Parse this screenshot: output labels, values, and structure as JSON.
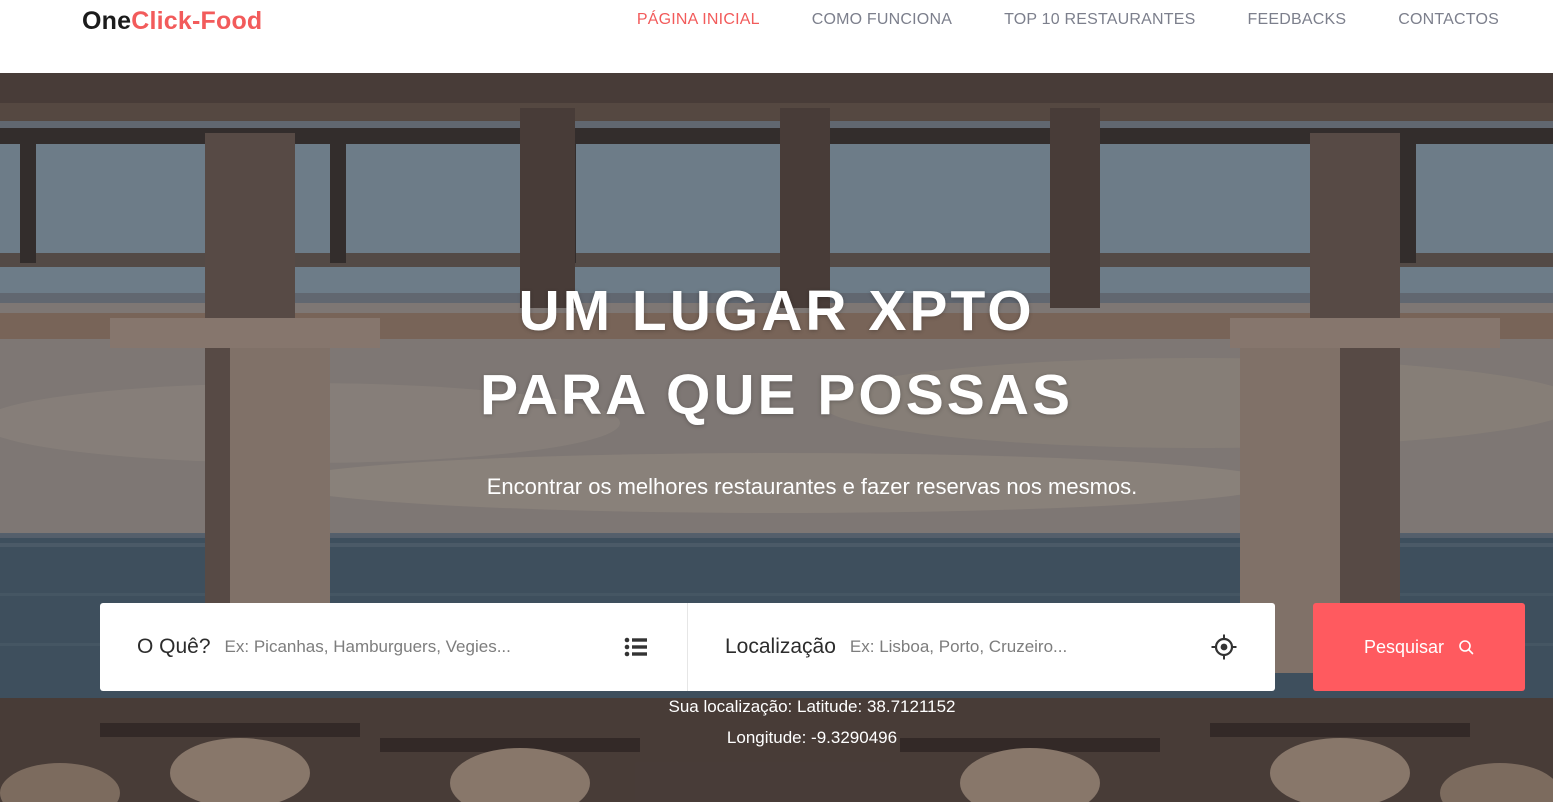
{
  "header": {
    "logo_part_a": "One",
    "logo_part_b": "Click-Food",
    "nav": [
      {
        "label": "PÁGINA INICIAL",
        "active": true
      },
      {
        "label": "COMO FUNCIONA",
        "active": false
      },
      {
        "label": "TOP 10 RESTAURANTES",
        "active": false
      },
      {
        "label": "FEEDBACKS",
        "active": false
      },
      {
        "label": "CONTACTOS",
        "active": false
      }
    ]
  },
  "hero": {
    "title_line1": "UM LUGAR XPTO",
    "title_line2": "PARA QUE POSSAS",
    "subtitle": "Encontrar os melhores restaurantes e fazer reservas nos mesmos."
  },
  "search": {
    "what_label": "O Quê?",
    "what_placeholder": "Ex: Picanhas, Hamburguers, Vegies...",
    "what_icon": "list-icon",
    "location_label": "Localização",
    "location_placeholder": "Ex: Lisboa, Porto, Cruzeiro...",
    "location_icon": "location-target-icon",
    "button_label": "Pesquisar",
    "button_icon": "search-icon"
  },
  "location_info": {
    "latitude_text": "Sua localização: Latitude: 38.7121152",
    "longitude_text": "Longitude: -9.3290496"
  },
  "colors": {
    "accent": "#ff5a5f",
    "logo_accent": "#f25b5b",
    "nav_text": "#7c7f8c"
  }
}
